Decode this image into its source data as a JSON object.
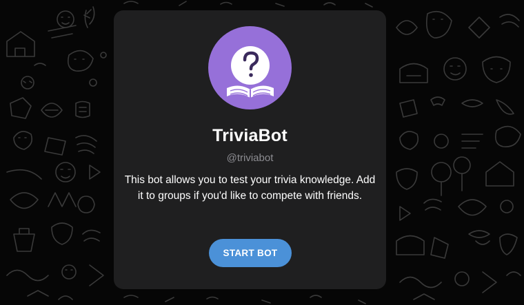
{
  "bot": {
    "name": "TriviaBot",
    "handle": "@triviabot",
    "description": "This bot allows you to test your trivia knowledge. Add it to groups if you'd like to compete with friends.",
    "avatar_icon": "question-book-icon",
    "avatar_color": "#9670d9"
  },
  "actions": {
    "start_label": "START BOT",
    "start_color": "#4b91d8"
  },
  "theme": {
    "background": "#060606",
    "card": "#1f1f20"
  }
}
